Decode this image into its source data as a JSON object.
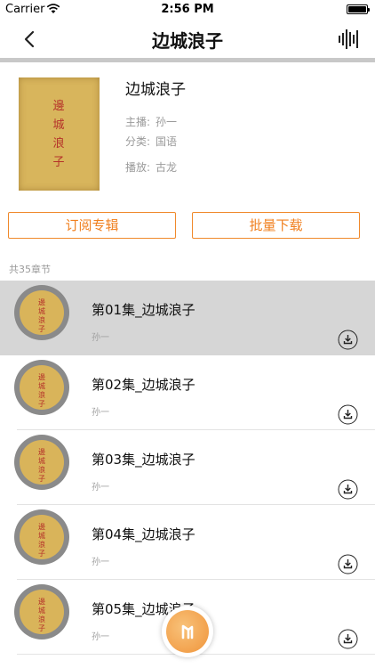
{
  "status": {
    "carrier": "Carrier",
    "time": "2:56 PM"
  },
  "nav": {
    "title": "边城浪子"
  },
  "album": {
    "title": "边城浪子",
    "anchor_label": "主播:",
    "anchor": "孙一",
    "category_label": "分类:",
    "category": "国语",
    "play_label": "播放:",
    "play": "古龙",
    "cover_title": "邊城浪子"
  },
  "buttons": {
    "subscribe": "订阅专辑",
    "batch_download": "批量下载"
  },
  "count_text": "共35章节",
  "episodes": [
    {
      "title": "第01集_边城浪子",
      "author": "孙一"
    },
    {
      "title": "第02集_边城浪子",
      "author": "孙一"
    },
    {
      "title": "第03集_边城浪子",
      "author": "孙一"
    },
    {
      "title": "第04集_边城浪子",
      "author": "孙一"
    },
    {
      "title": "第05集_边城浪子",
      "author": "孙一"
    }
  ],
  "colors": {
    "accent": "#f08020",
    "selected_row": "#d6d6d6"
  }
}
